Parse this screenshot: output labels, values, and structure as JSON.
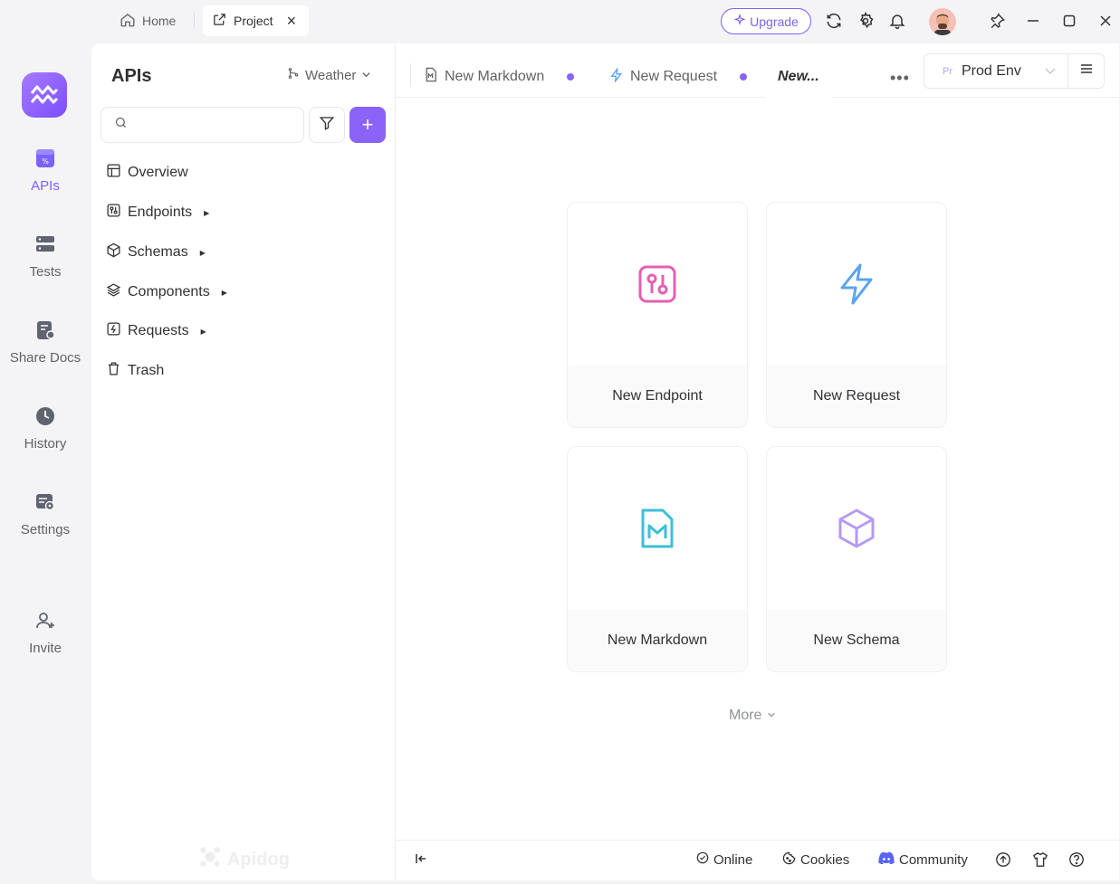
{
  "titlebar": {
    "tabs": [
      {
        "label": "Home",
        "icon": "home-icon"
      },
      {
        "label": "Project",
        "icon": "external-link-icon",
        "close": "×"
      }
    ],
    "upgrade_label": "Upgrade",
    "icons": [
      "refresh-icon",
      "gear-icon",
      "bell-icon",
      "avatar",
      "pin-icon",
      "minimize-icon",
      "maximize-icon",
      "close-icon"
    ]
  },
  "rail": {
    "items": [
      {
        "label": "APIs",
        "icon": "apis-icon",
        "active": true
      },
      {
        "label": "Tests",
        "icon": "tests-icon"
      },
      {
        "label": "Share Docs",
        "icon": "share-docs-icon"
      },
      {
        "label": "History",
        "icon": "history-icon"
      },
      {
        "label": "Settings",
        "icon": "settings-icon"
      },
      {
        "label": "Invite",
        "icon": "invite-icon"
      }
    ]
  },
  "sidebar": {
    "title": "APIs",
    "branch": "Weather",
    "search_placeholder": "",
    "add_label": "+",
    "tree": [
      {
        "label": "Overview",
        "icon": "overview-icon",
        "caret": false
      },
      {
        "label": "Endpoints",
        "icon": "endpoints-icon",
        "caret": true
      },
      {
        "label": "Schemas",
        "icon": "schemas-icon",
        "caret": true
      },
      {
        "label": "Components",
        "icon": "components-icon",
        "caret": true
      },
      {
        "label": "Requests",
        "icon": "requests-icon",
        "caret": true
      },
      {
        "label": "Trash",
        "icon": "trash-icon",
        "caret": false
      }
    ],
    "watermark": "Apidog"
  },
  "main": {
    "tabs": [
      {
        "label": "New Markdown",
        "icon": "markdown-icon"
      },
      {
        "label": "New Request",
        "icon": "lightning-icon"
      },
      {
        "label": "New..."
      }
    ],
    "more_tabs": "•••",
    "env": {
      "prefix": "Pr",
      "label": "Prod Env"
    },
    "cards": [
      {
        "label": "New Endpoint",
        "icon": "endpoint-icon",
        "color": "#e45fb3"
      },
      {
        "label": "New Request",
        "icon": "lightning-icon",
        "color": "#5aa3ef"
      },
      {
        "label": "New Markdown",
        "icon": "markdown-icon",
        "color": "#3cbfd6"
      },
      {
        "label": "New Schema",
        "icon": "cube-icon",
        "color": "#b49af1"
      }
    ],
    "more_label": "More",
    "footer": {
      "online": "Online",
      "cookies": "Cookies",
      "community": "Community"
    }
  },
  "colors": {
    "accent": "#8a63f8",
    "upgrade": "#7b61ff"
  }
}
